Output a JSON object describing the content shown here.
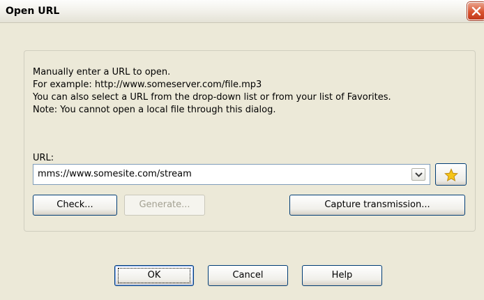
{
  "dialog": {
    "title": "Open URL",
    "close_label": "Close"
  },
  "info_lines": [
    "Manually enter a URL to open.",
    "For example: http://www.someserver.com/file.mp3",
    "You can also select a URL from the drop-down list or from your list of Favorites.",
    "Note: You cannot open a local file through this dialog."
  ],
  "url": {
    "label": "URL:",
    "value": "mms://www.somesite.com/stream"
  },
  "buttons": {
    "check": "Check...",
    "generate": "Generate...",
    "capture": "Capture transmission...",
    "ok": "OK",
    "cancel": "Cancel",
    "help": "Help"
  },
  "icons": {
    "close": "close-icon",
    "dropdown": "chevron-down-icon",
    "favorites": "star-icon"
  },
  "colors": {
    "dialog_bg": "#ece9d8",
    "close_button": "#d9532f",
    "button_border": "#003c74",
    "input_border": "#7f9db9",
    "star": "#f5c518"
  }
}
